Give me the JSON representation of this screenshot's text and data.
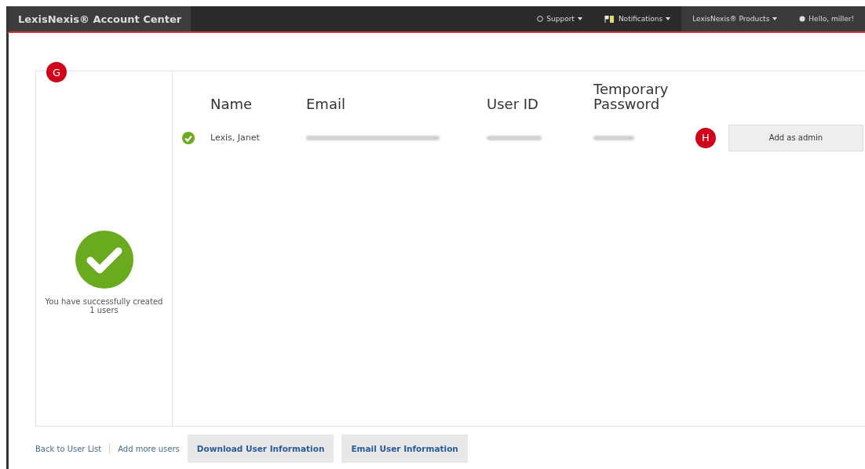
{
  "header": {
    "title": "LexisNexis® Account Center",
    "menus": [
      {
        "label": "Support"
      },
      {
        "label": "Notifications"
      },
      {
        "label": "LexisNexis® Products"
      },
      {
        "label": "Hello, miller!"
      }
    ]
  },
  "callouts": [
    "G",
    "H"
  ],
  "summary": {
    "message": "You have successfully created 1 users"
  },
  "table": {
    "columns": [
      "Name",
      "Email",
      "User ID",
      "Temporary Password"
    ],
    "rows": [
      {
        "name": "Lexis, Janet",
        "action": "Add as admin"
      }
    ]
  },
  "footer": {
    "links": [
      "Back to User List",
      "Add more users"
    ],
    "buttons": [
      "Download User Information",
      "Email User Information"
    ]
  }
}
